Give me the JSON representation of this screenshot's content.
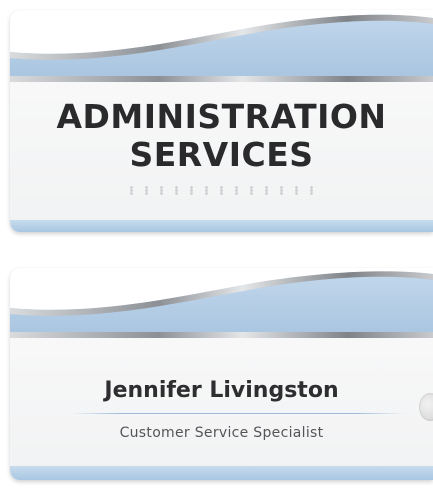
{
  "sign_top": {
    "title_line1": "ADMINISTRATION",
    "title_line2": "SERVICES",
    "braille_label": "braille"
  },
  "sign_bottom": {
    "name": "Jennifer Livingston",
    "role": "Customer Service Specialist"
  },
  "colors": {
    "header_blue": "#b5cfe6",
    "silver": "#9a9ea3",
    "text_dark": "#2a2a2c"
  }
}
